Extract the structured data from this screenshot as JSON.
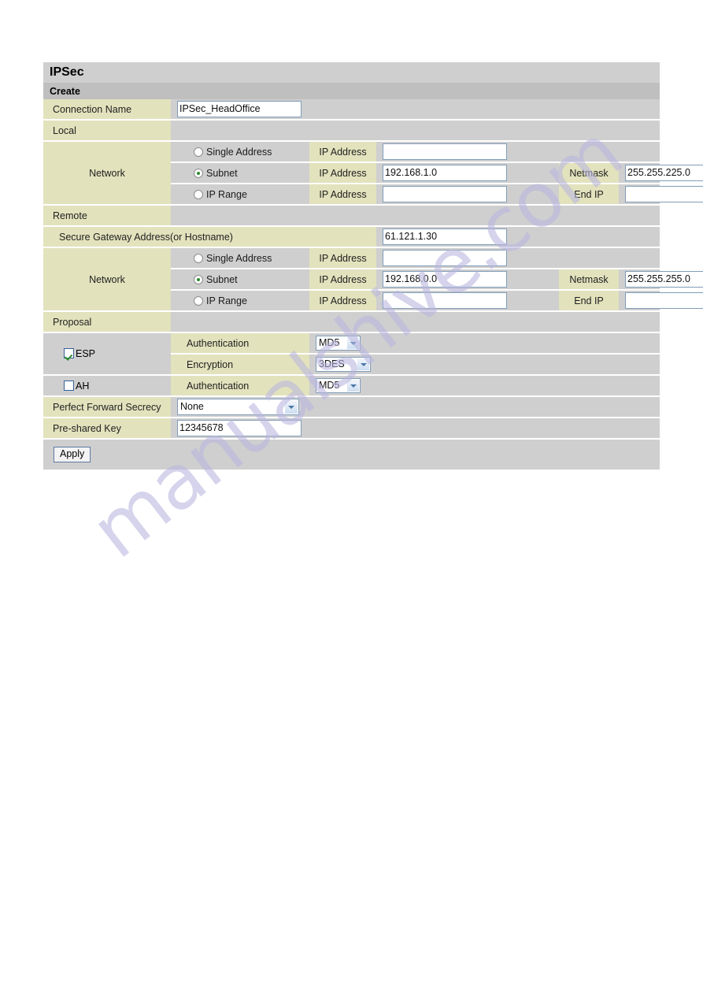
{
  "panel": {
    "title": "IPSec",
    "section": "Create"
  },
  "form": {
    "connection_name": {
      "label": "Connection Name",
      "value": "IPSec_HeadOffice"
    },
    "local": {
      "label": "Local",
      "network_label": "Network",
      "modes": [
        {
          "id": "single-address",
          "label": "Single Address",
          "selected": false,
          "field_label": "IP Address",
          "value": ""
        },
        {
          "id": "subnet",
          "label": "Subnet",
          "selected": true,
          "field_label": "IP Address",
          "value": "192.168.1.0",
          "extra_label": "Netmask",
          "extra_value": "255.255.225.0"
        },
        {
          "id": "ip-range",
          "label": "IP Range",
          "selected": false,
          "field_label": "IP Address",
          "value": "",
          "extra_label": "End IP",
          "extra_value": ""
        }
      ]
    },
    "remote": {
      "label": "Remote",
      "secure_gateway": {
        "label": "Secure Gateway Address(or Hostname)",
        "value": "61.121.1.30"
      },
      "network_label": "Network",
      "modes": [
        {
          "id": "single-address",
          "label": "Single Address",
          "selected": false,
          "field_label": "IP Address",
          "value": ""
        },
        {
          "id": "subnet",
          "label": "Subnet",
          "selected": true,
          "field_label": "IP Address",
          "value": "192.168.0.0",
          "extra_label": "Netmask",
          "extra_value": "255.255.255.0"
        },
        {
          "id": "ip-range",
          "label": "IP Range",
          "selected": false,
          "field_label": "IP Address",
          "value": "",
          "extra_label": "End IP",
          "extra_value": ""
        }
      ]
    },
    "proposal": {
      "label": "Proposal",
      "esp": {
        "label": "ESP",
        "checked": true,
        "authentication": {
          "label": "Authentication",
          "value": "MD5"
        },
        "encryption": {
          "label": "Encryption",
          "value": "3DES"
        }
      },
      "ah": {
        "label": "AH",
        "checked": false,
        "authentication": {
          "label": "Authentication",
          "value": "MD5"
        }
      }
    },
    "perfect_forward_secrecy": {
      "label": "Perfect Forward Secrecy",
      "value": "None"
    },
    "pre_shared_key": {
      "label": "Pre-shared Key",
      "value": "12345678"
    },
    "apply_button": "Apply"
  },
  "watermark": {
    "text": "manualshive.com",
    "color": "#b9b6e0"
  }
}
